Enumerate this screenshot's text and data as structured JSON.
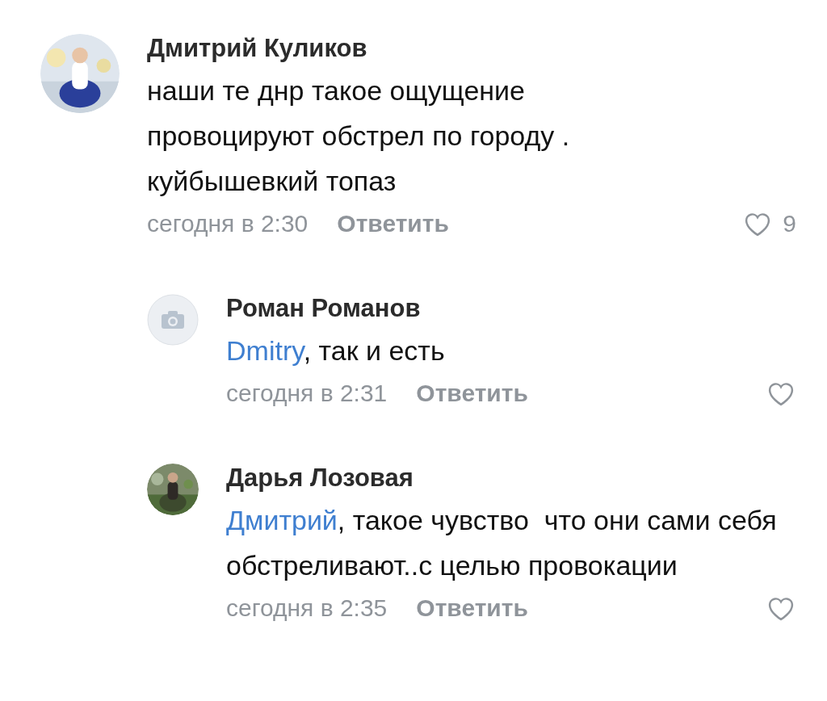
{
  "comments": [
    {
      "author": "Дмитрий Куликов",
      "text": "наши те днр такое ощущение провоцируют обстрел по городу . куйбышевкий топаз",
      "time": "сегодня в 2:30",
      "reply_label": "Ответить",
      "likes": "9",
      "children": [
        {
          "author": "Роман Романов",
          "avatar": {
            "kind": "placeholder"
          },
          "mention": "Dmitry",
          "text": ", так и есть",
          "time": "сегодня в 2:31",
          "reply_label": "Ответить"
        },
        {
          "author": "Дарья Лозовая",
          "mention": "Дмитрий",
          "text": ", такое чувство  что они сами себя обстреливают..с целью провокации",
          "time": "сегодня в 2:35",
          "reply_label": "Ответить"
        }
      ]
    }
  ]
}
